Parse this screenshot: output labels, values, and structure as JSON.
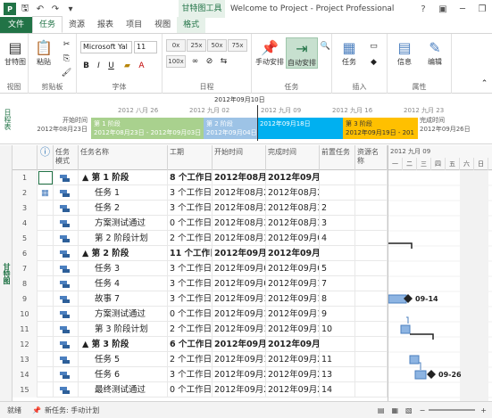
{
  "window": {
    "title": "Welcome to Project - Project Professional",
    "context_tab_group": "甘特图工具",
    "app_letter": "P"
  },
  "tabs": [
    {
      "label": "文件"
    },
    {
      "label": "任务"
    },
    {
      "label": "资源"
    },
    {
      "label": "报表"
    },
    {
      "label": "项目"
    },
    {
      "label": "视图"
    },
    {
      "label": "格式"
    }
  ],
  "ribbon": {
    "view_group": {
      "button": "甘特图",
      "label": "视图"
    },
    "clipboard_group": {
      "paste": "粘贴",
      "label": "剪贴板"
    },
    "font_group": {
      "font_name": "Microsoft Yal",
      "font_size": "11",
      "bold": "B",
      "italic": "I",
      "underline": "U",
      "label": "字体"
    },
    "schedule_group": {
      "label": "日程",
      "pct_buttons": [
        "0x",
        "25x",
        "50x",
        "75x",
        "100x"
      ]
    },
    "tasks_group": {
      "manual": "手动安排",
      "auto": "自动安排",
      "label": "任务"
    },
    "insert_group": {
      "task": "任务",
      "label": "插入"
    },
    "properties_group": {
      "info": "信息",
      "edit": "编辑",
      "label": "属性"
    }
  },
  "timeline": {
    "side_label": "日程表",
    "today": "2012年09月10日",
    "start_label": "开始时间",
    "start_date": "2012年08月23日",
    "finish_label": "完成时间",
    "finish_date": "2012年09月26日",
    "scale": [
      "2012 八月 26",
      "2012 九月 02",
      "2012 九月 09",
      "2012 九月 16",
      "2012 九月 23"
    ],
    "bars": [
      {
        "name": "第 1 阶段",
        "dates": "2012年08月23日 - 2012年09月03日",
        "color": "#a9d18e"
      },
      {
        "name": "第 2 阶段",
        "dates": "2012年09月04日 -",
        "color": "#9dc3e6"
      },
      {
        "name": "",
        "dates": "2012年09月18日",
        "color": "#00b0f0"
      },
      {
        "name": "第 3 阶段",
        "dates": "2012年09月19日 - 201",
        "color": "#ffc000"
      }
    ]
  },
  "sheet": {
    "side_label": "甘特图",
    "headers": {
      "info": "ⓘ",
      "mode": "任务模式",
      "name": "任务名称",
      "duration": "工期",
      "start": "开始时间",
      "finish": "完成时间",
      "predecessors": "前置任务",
      "resources": "资源名称"
    },
    "rows": [
      {
        "id": "1",
        "name": "▲ 第 1 阶段",
        "summary": true,
        "indent": 0,
        "duration": "8 个工作日",
        "start": "2012年08月2",
        "finish": "2012年09月0",
        "pred": ""
      },
      {
        "id": "2",
        "name": "任务 1",
        "summary": false,
        "indent": 1,
        "duration": "3 个工作日",
        "start": "2012年08月2",
        "finish": "2012年08月2",
        "pred": ""
      },
      {
        "id": "3",
        "name": "任务 2",
        "summary": false,
        "indent": 1,
        "duration": "3 个工作日",
        "start": "2012年08月2",
        "finish": "2012年08月3",
        "pred": "2"
      },
      {
        "id": "4",
        "name": "方案测试通过",
        "summary": false,
        "indent": 1,
        "duration": "0 个工作日",
        "start": "2012年08月3",
        "finish": "2012年08月3",
        "pred": "3"
      },
      {
        "id": "5",
        "name": "第 2 阶段计划",
        "summary": false,
        "indent": 1,
        "duration": "2 个工作日",
        "start": "2012年08月3",
        "finish": "2012年09月0",
        "pred": "4"
      },
      {
        "id": "6",
        "name": "▲ 第 2 阶段",
        "summary": true,
        "indent": 0,
        "duration": "11 个工作日",
        "start": "2012年09月0",
        "finish": "2012年09月1",
        "pred": ""
      },
      {
        "id": "7",
        "name": "任务 3",
        "summary": false,
        "indent": 1,
        "duration": "3 个工作日",
        "start": "2012年09月0",
        "finish": "2012年09月0",
        "pred": "5"
      },
      {
        "id": "8",
        "name": "任务 4",
        "summary": false,
        "indent": 1,
        "duration": "3 个工作日",
        "start": "2012年09月0",
        "finish": "2012年09月1",
        "pred": "7"
      },
      {
        "id": "9",
        "name": "故事 7",
        "summary": false,
        "indent": 1,
        "duration": "3 个工作日",
        "start": "2012年09月1",
        "finish": "2012年09月1",
        "pred": "8"
      },
      {
        "id": "10",
        "name": "方案测试通过",
        "summary": false,
        "indent": 1,
        "duration": "0 个工作日",
        "start": "2012年09月1",
        "finish": "2012年09月1",
        "pred": "9"
      },
      {
        "id": "11",
        "name": "第 3 阶段计划",
        "summary": false,
        "indent": 1,
        "duration": "2 个工作日",
        "start": "2012年09月1",
        "finish": "2012年09月1",
        "pred": "10"
      },
      {
        "id": "12",
        "name": "▲ 第 3 阶段",
        "summary": true,
        "indent": 0,
        "duration": "6 个工作日",
        "start": "2012年09月1",
        "finish": "2012年09月2",
        "pred": ""
      },
      {
        "id": "13",
        "name": "任务 5",
        "summary": false,
        "indent": 1,
        "duration": "2 个工作日",
        "start": "2012年09月1",
        "finish": "2012年09月2",
        "pred": "11"
      },
      {
        "id": "14",
        "name": "任务 6",
        "summary": false,
        "indent": 1,
        "duration": "3 个工作日",
        "start": "2012年09月2",
        "finish": "2012年09月2",
        "pred": "13"
      },
      {
        "id": "15",
        "name": "最终测试通过",
        "summary": false,
        "indent": 1,
        "duration": "0 个工作日",
        "start": "2012年09月2",
        "finish": "2012年09月2",
        "pred": "14"
      }
    ]
  },
  "gantt": {
    "header_top": "2012 九月 09",
    "days": [
      "一",
      "二",
      "三",
      "四",
      "五",
      "六",
      "日"
    ],
    "milestones": [
      {
        "row": 9,
        "label": "09-14"
      },
      {
        "row": 14,
        "label": "09-26"
      }
    ]
  },
  "status": {
    "ready": "就绪",
    "new_tasks": "新任务: 手动计划"
  }
}
